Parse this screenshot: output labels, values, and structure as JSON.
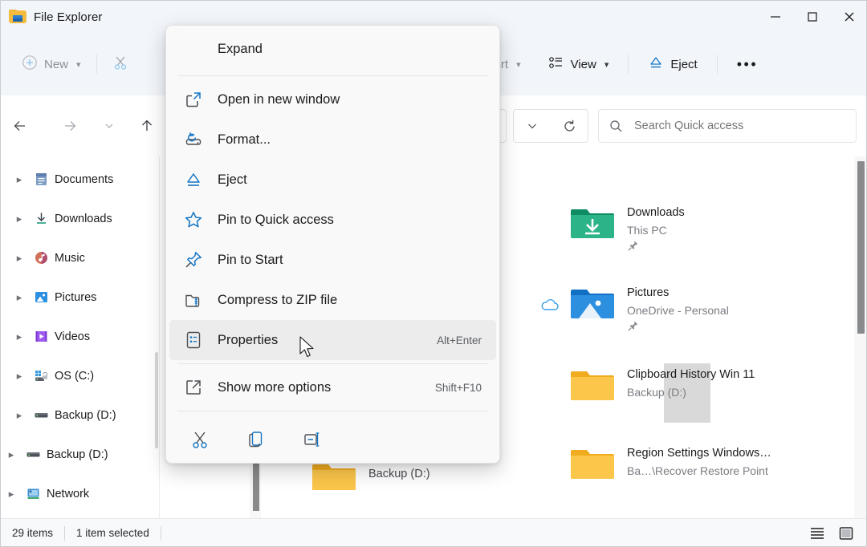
{
  "window": {
    "title": "File Explorer",
    "icon": "folder-icon",
    "minimize_label": "Minimize",
    "maximize_label": "Maximize",
    "close_label": "Close"
  },
  "toolbar": {
    "new_label": "New",
    "cut_icon": "scissors-icon",
    "sort_label": "Sort",
    "view_label": "View",
    "eject_label": "Eject",
    "more_label": "•••"
  },
  "navbar": {
    "back_icon": "back-arrow-icon",
    "forward_icon": "forward-arrow-icon",
    "recent_icon": "chevron-down-icon",
    "up_icon": "up-arrow-icon",
    "address_dropdown_icon": "chevron-down-icon",
    "refresh_icon": "refresh-icon",
    "search_icon": "search-icon",
    "search_placeholder": "Search Quick access",
    "search_value": ""
  },
  "sidebar": {
    "items": [
      {
        "label": "Documents",
        "icon": "documents-icon",
        "level": 2,
        "expandable": true
      },
      {
        "label": "Downloads",
        "icon": "downloads-icon",
        "level": 2,
        "expandable": true
      },
      {
        "label": "Music",
        "icon": "music-icon",
        "level": 2,
        "expandable": true
      },
      {
        "label": "Pictures",
        "icon": "pictures-icon",
        "level": 2,
        "expandable": true
      },
      {
        "label": "Videos",
        "icon": "videos-icon",
        "level": 2,
        "expandable": true
      },
      {
        "label": "OS (C:)",
        "icon": "os-drive-icon",
        "level": 2,
        "expandable": true
      },
      {
        "label": "Backup (D:)",
        "icon": "drive-icon",
        "level": 2,
        "expandable": true
      },
      {
        "label": "Backup (D:)",
        "icon": "drive-icon",
        "level": 1,
        "expandable": true
      },
      {
        "label": "Network",
        "icon": "network-icon",
        "level": 1,
        "expandable": true
      }
    ]
  },
  "content": {
    "items": [
      {
        "name": "Downloads",
        "sub": "This PC",
        "icon": "downloads-folder-icon",
        "pinned": true,
        "cloud": false
      },
      {
        "name": "Pictures",
        "sub": "OneDrive - Personal",
        "icon": "pictures-folder-icon",
        "pinned": true,
        "cloud": true
      },
      {
        "name": "Clipboard History Win 11",
        "sub": "Backup (D:)",
        "icon": "folder-icon",
        "pinned": false,
        "cloud": false
      },
      {
        "name": "Region Settings Windows…",
        "sub": "Ba…\\Recover Restore Point",
        "icon": "folder-icon",
        "pinned": false,
        "cloud": false
      },
      {
        "name": "Backup (D:)",
        "sub": "",
        "icon": "folder-icon",
        "pinned": false,
        "cloud": false
      }
    ]
  },
  "context_menu": {
    "header": {
      "label": "Expand"
    },
    "items": [
      {
        "label": "Open in new window",
        "icon": "open-new-window-icon",
        "accel": "",
        "highlighted": false
      },
      {
        "label": "Format...",
        "icon": "format-icon",
        "accel": "",
        "highlighted": false
      },
      {
        "label": "Eject",
        "icon": "eject-icon",
        "accel": "",
        "highlighted": false
      },
      {
        "label": "Pin to Quick access",
        "icon": "star-icon",
        "accel": "",
        "highlighted": false
      },
      {
        "label": "Pin to Start",
        "icon": "pin-icon",
        "accel": "",
        "highlighted": false
      },
      {
        "label": "Compress to ZIP file",
        "icon": "zip-folder-icon",
        "accel": "",
        "highlighted": false
      },
      {
        "label": "Properties",
        "icon": "properties-icon",
        "accel": "Alt+Enter",
        "highlighted": true
      },
      {
        "label": "Show more options",
        "icon": "show-more-icon",
        "accel": "Shift+F10",
        "highlighted": false
      }
    ],
    "action_icons": [
      {
        "name": "cut-icon"
      },
      {
        "name": "copy-icon"
      },
      {
        "name": "rename-icon"
      }
    ]
  },
  "statusbar": {
    "item_count": "29 items",
    "selection": "1 item selected",
    "details_view_icon": "details-view-icon",
    "preview_pane_icon": "preview-pane-icon"
  },
  "colors": {
    "accent": "#0f6cbd",
    "titlebar_bg": "#f2f5fa",
    "menu_bg": "#f9f9f9",
    "highlight": "#ececec",
    "folder_yellow": "#fbc64a",
    "folder_green": "#17a07a",
    "folder_blue": "#2c8fe0"
  }
}
